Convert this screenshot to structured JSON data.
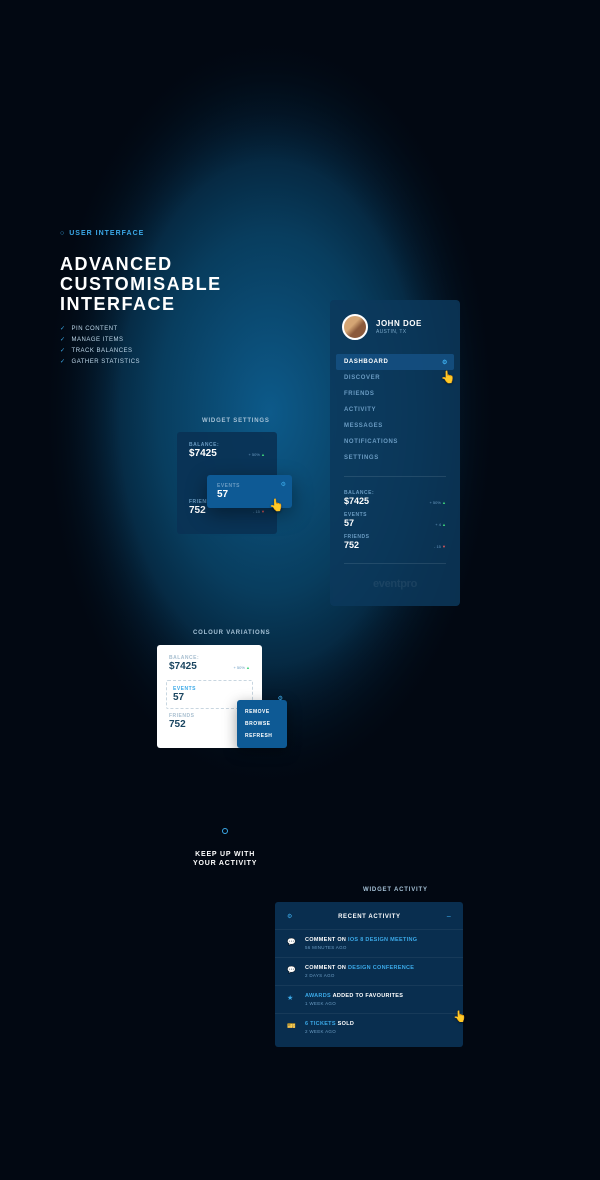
{
  "eyebrow": "USER INTERFACE",
  "headline": {
    "l1": "ADVANCED",
    "l2": "CUSTOMISABLE",
    "l3": "INTERFACE"
  },
  "features": [
    "PIN CONTENT",
    "MANAGE ITEMS",
    "TRACK BALANCES",
    "GATHER STATISTICS"
  ],
  "labels": {
    "widget_settings": "WIDGET SETTINGS",
    "colour_variations": "COLOUR VARIATIONS",
    "keep_up_l1": "KEEP UP WITH",
    "keep_up_l2": "YOUR ACTIVITY",
    "widget_activity": "WIDGET ACTIVITY"
  },
  "sidebar": {
    "profile_name": "JOHN DOE",
    "profile_location": "AUSTIN, TX",
    "nav": [
      "DASHBOARD",
      "DISCOVER",
      "FRIENDS",
      "ACTIVITY",
      "MESSAGES",
      "NOTIFICATIONS",
      "SETTINGS"
    ],
    "stats": {
      "balance": {
        "label": "BALANCE:",
        "value": "$7425",
        "delta": "+ 50%"
      },
      "events": {
        "label": "EVENTS",
        "value": "57",
        "delta": "+ 4"
      },
      "friends": {
        "label": "FRIENDS",
        "value": "752",
        "delta": "- 15"
      }
    },
    "brand": "eventpro"
  },
  "widget_card": {
    "balance": {
      "label": "BALANCE:",
      "value": "$7425",
      "delta": "+ 50%"
    },
    "events": {
      "label": "EVENTS",
      "value": "57"
    },
    "friends": {
      "label": "FRIENDS",
      "value": "752",
      "delta": "- 15"
    }
  },
  "colour_card": {
    "balance": {
      "label": "BALANCE:",
      "value": "$7425",
      "delta": "+ 50%"
    },
    "events": {
      "label": "EVENTS",
      "value": "57"
    },
    "friends": {
      "label": "FRIENDS",
      "value": "752"
    }
  },
  "context_menu": [
    "REMOVE",
    "BROWSE",
    "REFRESH"
  ],
  "activity": {
    "title": "RECENT ACTIVITY",
    "items": [
      {
        "icon": "💬",
        "pre": "COMMENT ON ",
        "hl": "IOS 8 DESIGN MEETING",
        "post": "",
        "time": "56 MINUTES AGO"
      },
      {
        "icon": "💬",
        "pre": "COMMENT ON ",
        "hl": "DESIGN CONFERENCE",
        "post": "",
        "time": "2 DAYS AGO"
      },
      {
        "icon": "★",
        "pre": "",
        "hl": "AWARDS",
        "post": " ADDED TO FAVOURITES",
        "time": "1 WEEK AGO"
      },
      {
        "icon": "🎫",
        "pre": "",
        "hl": "6 TICKETS",
        "post": " SOLD",
        "time": "2 WEEK AGO"
      }
    ]
  }
}
